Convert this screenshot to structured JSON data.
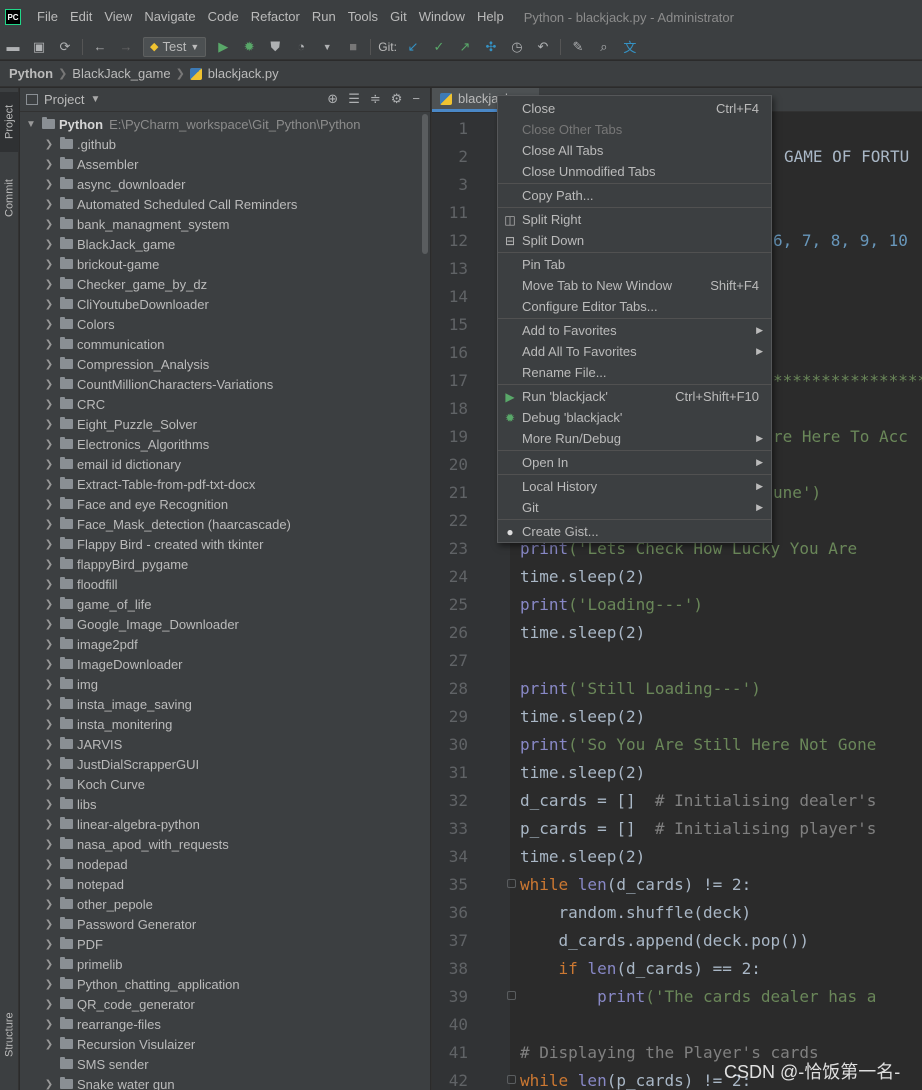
{
  "menubar": {
    "logo": "PC",
    "items": [
      "File",
      "Edit",
      "View",
      "Navigate",
      "Code",
      "Refactor",
      "Run",
      "Tools",
      "Git",
      "Window",
      "Help"
    ],
    "window_title": "Python - blackjack.py - Administrator"
  },
  "toolbar": {
    "run_config": "Test",
    "git_label": "Git:"
  },
  "breadcrumb": {
    "items": [
      "Python",
      "BlackJack_game",
      "blackjack.py"
    ]
  },
  "left_stripe": {
    "project": "Project",
    "commit": "Commit",
    "structure": "Structure"
  },
  "project_panel": {
    "title": "Project",
    "root": {
      "name": "Python",
      "path": "E:\\PyCharm_workspace\\Git_Python\\Python"
    },
    "items": [
      ".github",
      "Assembler",
      "async_downloader",
      "Automated Scheduled Call Reminders",
      "bank_managment_system",
      "BlackJack_game",
      "brickout-game",
      "Checker_game_by_dz",
      "CliYoutubeDownloader",
      "Colors",
      "communication",
      "Compression_Analysis",
      "CountMillionCharacters-Variations",
      "CRC",
      "Eight_Puzzle_Solver",
      "Electronics_Algorithms",
      "email id dictionary",
      "Extract-Table-from-pdf-txt-docx",
      "Face and eye Recognition",
      "Face_Mask_detection (haarcascade)",
      "Flappy Bird - created with tkinter",
      "flappyBird_pygame",
      "floodfill",
      "game_of_life",
      "Google_Image_Downloader",
      "image2pdf",
      "ImageDownloader",
      "img",
      "insta_image_saving",
      "insta_monitering",
      "JARVIS",
      "JustDialScrapperGUI",
      "Koch Curve",
      "libs",
      "linear-algebra-python",
      "nasa_apod_with_requests",
      "nodepad",
      "notepad",
      "other_pepole",
      "Password Generator",
      "PDF",
      "primelib",
      "Python_chatting_application",
      "QR_code_generator",
      "rearrange-files",
      "Recursion Visulaizer",
      "SMS sender",
      "Snake water gun"
    ]
  },
  "editor": {
    "tab_label": "blackjack.py",
    "line_numbers": [
      "1",
      "2",
      "3",
      "11",
      "12",
      "13",
      "14",
      "15",
      "16",
      "17",
      "18",
      "19",
      "20",
      "21",
      "22",
      "23",
      "24",
      "25",
      "26",
      "27",
      "28",
      "29",
      "30",
      "31",
      "32",
      "33",
      "34",
      "35",
      "36",
      "37",
      "38",
      "39",
      "40",
      "41",
      "42"
    ],
    "code": {
      "l2": "GAME OF FORTU",
      "l12": "6, 7, 8, 9, 10",
      "l17": "****************",
      "l19": "re Here To Acc",
      "l21": "une')",
      "l23_fn": "print",
      "l23_str": "('Lets Check How Lucky You Are",
      "l24": "time.sleep(2)",
      "l25_fn": "print",
      "l25_str": "('Loading---')",
      "l26": "time.sleep(2)",
      "l28_fn": "print",
      "l28_str": "('Still Loading---')",
      "l29": "time.sleep(2)",
      "l30_fn": "print",
      "l30_str": "('So You Are Still Here Not Gone",
      "l31": "time.sleep(2)",
      "l32_code": "d_cards = []  ",
      "l32_cm": "# Initialising dealer's",
      "l33_code": "p_cards = []  ",
      "l33_cm": "# Initialising player's",
      "l34": "time.sleep(2)",
      "l35_kw": "while ",
      "l35_bi": "len",
      "l35_rest": "(d_cards) != 2:",
      "l36": "    random.shuffle(deck)",
      "l37": "    d_cards.append(deck.pop())",
      "l38_kw": "    if ",
      "l38_bi": "len",
      "l38_rest": "(d_cards) == 2:",
      "l39_fn": "        print",
      "l39_str": "('The cards dealer has a",
      "l41": "# Displaying the Player's cards",
      "l42_kw": "while ",
      "l42_bi": "len",
      "l42_rest": "(p_cards) != 2:"
    }
  },
  "context_menu": {
    "items": [
      {
        "label": "Close",
        "shortcut": "Ctrl+F4"
      },
      {
        "label": "Close Other Tabs",
        "disabled": true
      },
      {
        "label": "Close All Tabs"
      },
      {
        "label": "Close Unmodified Tabs"
      },
      {
        "label": "Copy Path..."
      },
      {
        "label": "Split Right"
      },
      {
        "label": "Split Down"
      },
      {
        "label": "Pin Tab"
      },
      {
        "label": "Move Tab to New Window",
        "shortcut": "Shift+F4"
      },
      {
        "label": "Configure Editor Tabs..."
      },
      {
        "label": "Add to Favorites"
      },
      {
        "label": "Add All To Favorites"
      },
      {
        "label": "Rename File..."
      },
      {
        "label": "Run 'blackjack'",
        "shortcut": "Ctrl+Shift+F10"
      },
      {
        "label": "Debug 'blackjack'"
      },
      {
        "label": "More Run/Debug"
      },
      {
        "label": "Open In"
      },
      {
        "label": "Local History"
      },
      {
        "label": "Git"
      },
      {
        "label": "Create Gist..."
      }
    ]
  },
  "watermark": "CSDN @-恰饭第一名-",
  "colors": {
    "background": "#2b2b2b",
    "panel": "#3c3f41",
    "keyword": "#cc7832",
    "string": "#6a8759",
    "number": "#6897bb",
    "comment": "#808080",
    "run_green": "#59a869",
    "accent_blue": "#4a88c7"
  }
}
